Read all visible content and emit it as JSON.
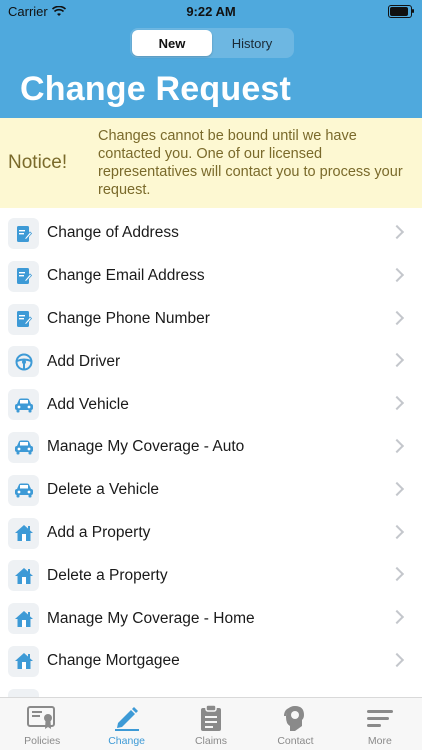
{
  "status_bar": {
    "carrier": "Carrier",
    "time": "9:22 AM"
  },
  "segments": [
    {
      "label": "New",
      "active": true
    },
    {
      "label": "History",
      "active": false
    }
  ],
  "header": {
    "title": "Change Request"
  },
  "notice": {
    "label": "Notice!",
    "text": "Changes cannot be bound until we have contacted you. One of our licensed representatives will contact you to process your request."
  },
  "list": {
    "items": [
      {
        "label": "Change of Address",
        "icon": "document-edit-icon"
      },
      {
        "label": "Change Email Address",
        "icon": "document-edit-icon"
      },
      {
        "label": "Change Phone Number",
        "icon": "document-edit-icon"
      },
      {
        "label": "Add Driver",
        "icon": "steering-wheel-icon"
      },
      {
        "label": "Add Vehicle",
        "icon": "car-icon"
      },
      {
        "label": "Manage My Coverage - Auto",
        "icon": "car-icon"
      },
      {
        "label": "Delete a Vehicle",
        "icon": "car-icon"
      },
      {
        "label": "Add a Property",
        "icon": "house-icon"
      },
      {
        "label": "Delete a Property",
        "icon": "house-icon"
      },
      {
        "label": "Manage My Coverage - Home",
        "icon": "house-icon"
      },
      {
        "label": "Change Mortgagee",
        "icon": "house-icon"
      }
    ]
  },
  "tabbar": {
    "items": [
      {
        "label": "Policies",
        "icon": "policy-certificate-icon",
        "active": false
      },
      {
        "label": "Change",
        "icon": "pencil-icon",
        "active": true
      },
      {
        "label": "Claims",
        "icon": "clipboard-icon",
        "active": false
      },
      {
        "label": "Contact",
        "icon": "support-agent-icon",
        "active": false
      },
      {
        "label": "More",
        "icon": "menu-lines-icon",
        "active": false
      }
    ]
  },
  "colors": {
    "header_blue": "#4fa9dd",
    "icon_blue": "#3d9ad6",
    "notice_bg": "#fdf8d2",
    "notice_text": "#7a6a2b"
  }
}
